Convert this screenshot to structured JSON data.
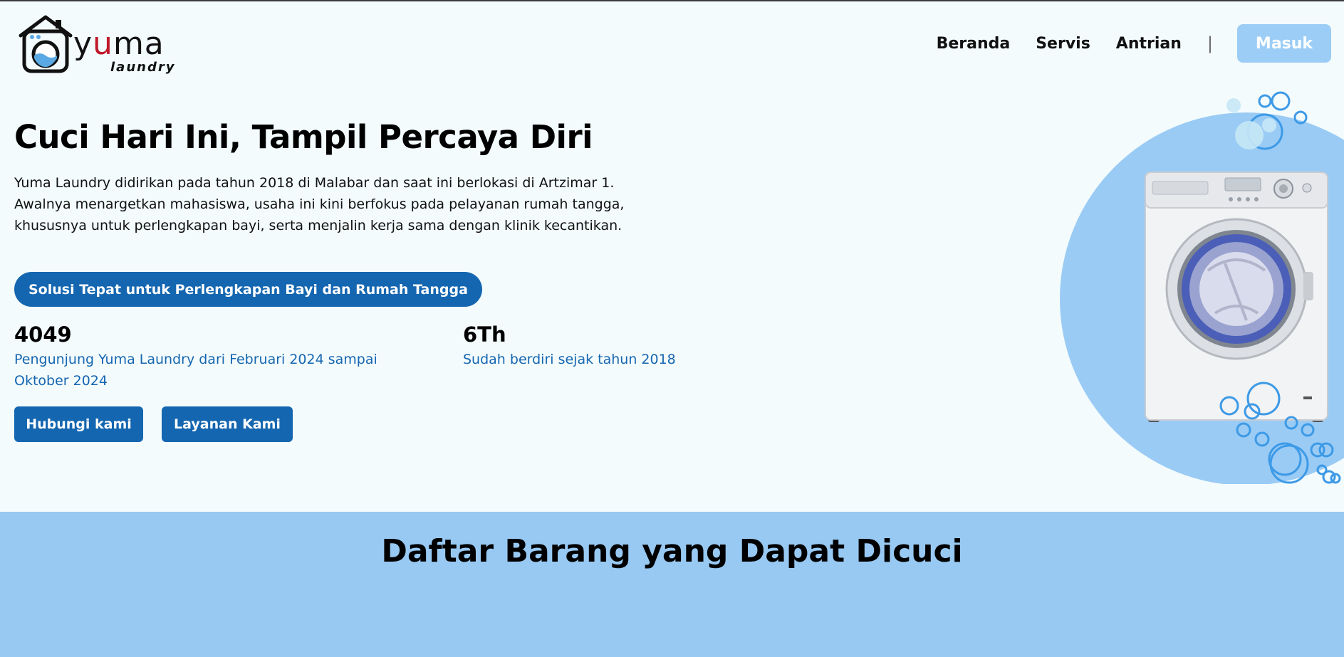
{
  "brand": {
    "name_part1": "y",
    "name_part2": "u",
    "name_part3": "ma",
    "sub": "laundry"
  },
  "nav": {
    "links": [
      "Beranda",
      "Servis",
      "Antrian"
    ],
    "separator": "|",
    "login_label": "Masuk"
  },
  "hero": {
    "title": "Cuci Hari Ini, Tampil Percaya Diri",
    "description": "Yuma Laundry didirikan pada tahun 2018 di Malabar dan saat ini berlokasi di Artzimar 1. Awalnya menargetkan mahasiswa, usaha ini kini berfokus pada pelayanan rumah tangga, khususnya untuk perlengkapan bayi, serta menjalin kerja sama dengan klinik kecantikan.",
    "pill": "Solusi Tepat untuk Perlengkapan Bayi dan Rumah Tangga",
    "stats": [
      {
        "number": "4049",
        "text": "Pengunjung Yuma Laundry dari Februari 2024 sampai Oktober 2024"
      },
      {
        "number": "6Th",
        "text": "Sudah berdiri sejak tahun 2018"
      }
    ],
    "buttons": {
      "contact": "Hubungi kami",
      "services": "Layanan Kami"
    }
  },
  "section2": {
    "title": "Daftar Barang yang Dapat Dicuci"
  },
  "colors": {
    "background": "#f3fbfd",
    "primary": "#1466b0",
    "light_blue": "#98c9f3",
    "login_button": "#9ccdf6",
    "logo_accent": "#c0182a"
  },
  "icons": [
    "house-washer-logo-icon",
    "washing-machine-illustration",
    "bubbles-decoration"
  ]
}
